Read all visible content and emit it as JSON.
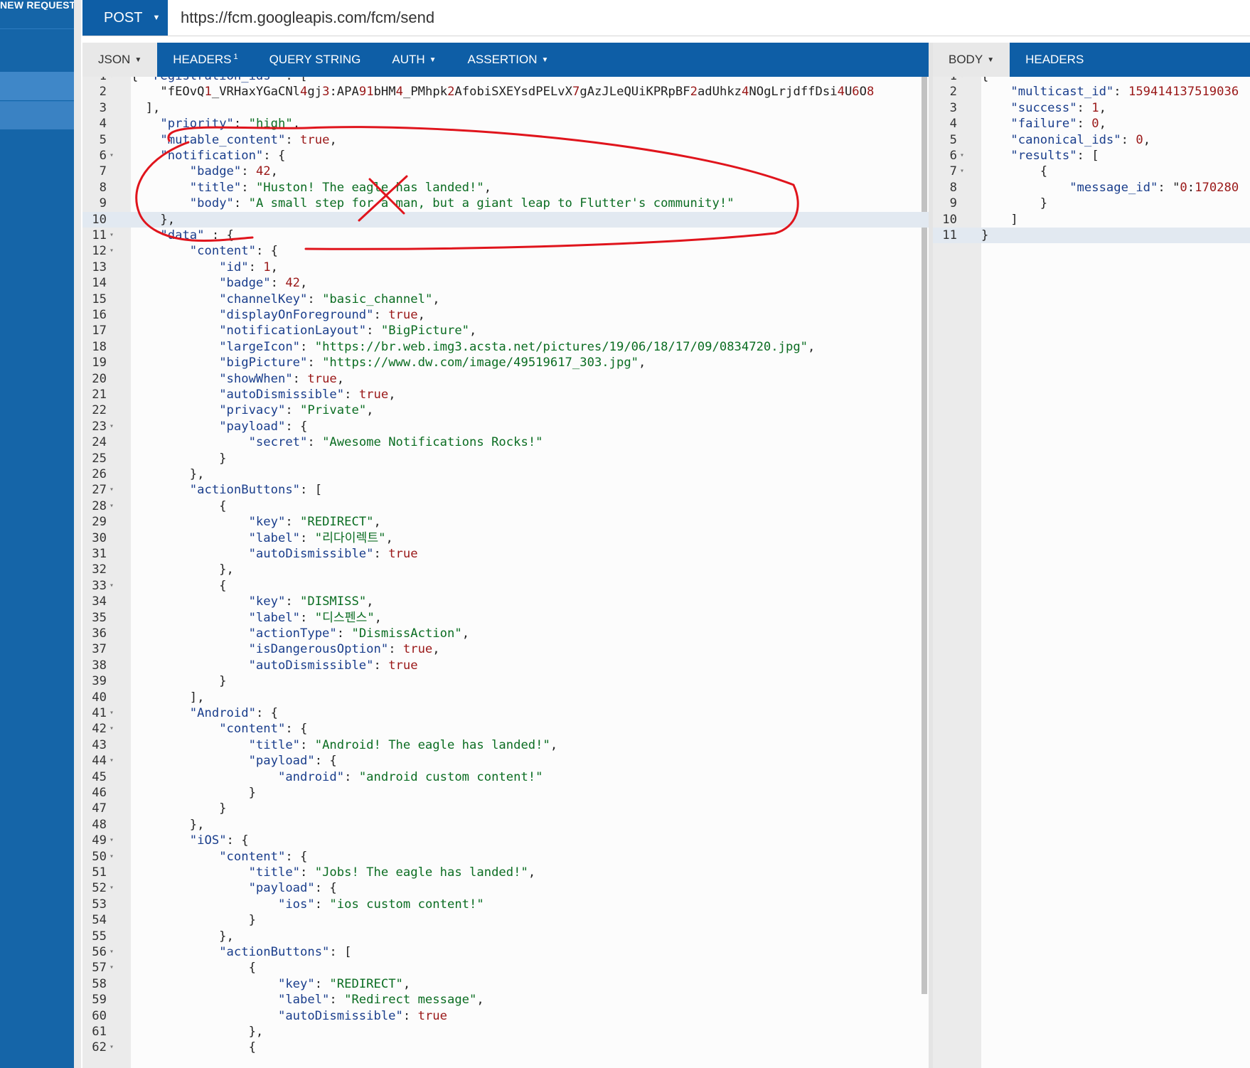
{
  "sidebar": {
    "new_request_label": "NEW REQUEST"
  },
  "request": {
    "method": "POST",
    "url": "https://fcm.googleapis.com/fcm/send",
    "tabs": [
      {
        "label": "JSON",
        "dropdown": true
      },
      {
        "label": "HEADERS",
        "badge": "1"
      },
      {
        "label": "QUERY STRING"
      },
      {
        "label": "AUTH",
        "dropdown": true
      },
      {
        "label": "ASSERTION",
        "dropdown": true
      }
    ],
    "editor": {
      "active_line": 10,
      "lines": [
        {
          "n": "1",
          "fold": true,
          "text": "{ \"registration_ids\" : ["
        },
        {
          "n": "2",
          "text": "    \"fEOvQ1_VRHaxYGaCNl4gj3:APA91bHM4_PMhpk2AfobiSXEYsdPELvX7gAzJLeQUiKPRpBF2adUhkz4NOgLrjdffDsi4U6O8"
        },
        {
          "n": "3",
          "text": "  ],"
        },
        {
          "n": "4",
          "text": "    \"priority\": \"high\","
        },
        {
          "n": "5",
          "text": "    \"mutable_content\": true,"
        },
        {
          "n": "6",
          "fold": true,
          "text": "    \"notification\": {"
        },
        {
          "n": "7",
          "text": "        \"badge\": 42,"
        },
        {
          "n": "8",
          "text": "        \"title\": \"Huston! The eagle has landed!\","
        },
        {
          "n": "9",
          "text": "        \"body\": \"A small step for a man, but a giant leap to Flutter's community!\""
        },
        {
          "n": "10",
          "text": "    },"
        },
        {
          "n": "11",
          "fold": true,
          "text": "    \"data\" : {"
        },
        {
          "n": "12",
          "fold": true,
          "text": "        \"content\": {"
        },
        {
          "n": "13",
          "text": "            \"id\": 1,"
        },
        {
          "n": "14",
          "text": "            \"badge\": 42,"
        },
        {
          "n": "15",
          "text": "            \"channelKey\": \"basic_channel\","
        },
        {
          "n": "16",
          "text": "            \"displayOnForeground\": true,"
        },
        {
          "n": "17",
          "text": "            \"notificationLayout\": \"BigPicture\","
        },
        {
          "n": "18",
          "text": "            \"largeIcon\": \"https://br.web.img3.acsta.net/pictures/19/06/18/17/09/0834720.jpg\","
        },
        {
          "n": "19",
          "text": "            \"bigPicture\": \"https://www.dw.com/image/49519617_303.jpg\","
        },
        {
          "n": "20",
          "text": "            \"showWhen\": true,"
        },
        {
          "n": "21",
          "text": "            \"autoDismissible\": true,"
        },
        {
          "n": "22",
          "text": "            \"privacy\": \"Private\","
        },
        {
          "n": "23",
          "fold": true,
          "text": "            \"payload\": {"
        },
        {
          "n": "24",
          "text": "                \"secret\": \"Awesome Notifications Rocks!\""
        },
        {
          "n": "25",
          "text": "            }"
        },
        {
          "n": "26",
          "text": "        },"
        },
        {
          "n": "27",
          "fold": true,
          "text": "        \"actionButtons\": ["
        },
        {
          "n": "28",
          "fold": true,
          "text": "            {"
        },
        {
          "n": "29",
          "text": "                \"key\": \"REDIRECT\","
        },
        {
          "n": "30",
          "text": "                \"label\": \"리다이렉트\","
        },
        {
          "n": "31",
          "text": "                \"autoDismissible\": true"
        },
        {
          "n": "32",
          "text": "            },"
        },
        {
          "n": "33",
          "fold": true,
          "text": "            {"
        },
        {
          "n": "34",
          "text": "                \"key\": \"DISMISS\","
        },
        {
          "n": "35",
          "text": "                \"label\": \"디스펜스\","
        },
        {
          "n": "36",
          "text": "                \"actionType\": \"DismissAction\","
        },
        {
          "n": "37",
          "text": "                \"isDangerousOption\": true,"
        },
        {
          "n": "38",
          "text": "                \"autoDismissible\": true"
        },
        {
          "n": "39",
          "text": "            }"
        },
        {
          "n": "40",
          "text": "        ],"
        },
        {
          "n": "41",
          "fold": true,
          "text": "        \"Android\": {"
        },
        {
          "n": "42",
          "fold": true,
          "text": "            \"content\": {"
        },
        {
          "n": "43",
          "text": "                \"title\": \"Android! The eagle has landed!\","
        },
        {
          "n": "44",
          "fold": true,
          "text": "                \"payload\": {"
        },
        {
          "n": "45",
          "text": "                    \"android\": \"android custom content!\""
        },
        {
          "n": "46",
          "text": "                }"
        },
        {
          "n": "47",
          "text": "            }"
        },
        {
          "n": "48",
          "text": "        },"
        },
        {
          "n": "49",
          "fold": true,
          "text": "        \"iOS\": {"
        },
        {
          "n": "50",
          "fold": true,
          "text": "            \"content\": {"
        },
        {
          "n": "51",
          "text": "                \"title\": \"Jobs! The eagle has landed!\","
        },
        {
          "n": "52",
          "fold": true,
          "text": "                \"payload\": {"
        },
        {
          "n": "53",
          "text": "                    \"ios\": \"ios custom content!\""
        },
        {
          "n": "54",
          "text": "                }"
        },
        {
          "n": "55",
          "text": "            },"
        },
        {
          "n": "56",
          "fold": true,
          "text": "            \"actionButtons\": ["
        },
        {
          "n": "57",
          "fold": true,
          "text": "                {"
        },
        {
          "n": "58",
          "text": "                    \"key\": \"REDIRECT\","
        },
        {
          "n": "59",
          "text": "                    \"label\": \"Redirect message\","
        },
        {
          "n": "60",
          "text": "                    \"autoDismissible\": true"
        },
        {
          "n": "61",
          "text": "                },"
        },
        {
          "n": "62",
          "fold": true,
          "text": "                {"
        }
      ]
    }
  },
  "response": {
    "tabs": [
      {
        "label": "BODY",
        "dropdown": true
      },
      {
        "label": "HEADERS"
      }
    ],
    "editor": {
      "active_line": 11,
      "lines": [
        {
          "n": "1",
          "fold": true,
          "text": "{"
        },
        {
          "n": "2",
          "text": "    \"multicast_id\": 159414137519036"
        },
        {
          "n": "3",
          "text": "    \"success\": 1,"
        },
        {
          "n": "4",
          "text": "    \"failure\": 0,"
        },
        {
          "n": "5",
          "text": "    \"canonical_ids\": 0,"
        },
        {
          "n": "6",
          "fold": true,
          "text": "    \"results\": ["
        },
        {
          "n": "7",
          "fold": true,
          "text": "        {"
        },
        {
          "n": "8",
          "text": "            \"message_id\": \"0:170280"
        },
        {
          "n": "9",
          "text": "        }"
        },
        {
          "n": "10",
          "text": "    ]"
        },
        {
          "n": "11",
          "text": "}"
        }
      ]
    }
  },
  "colors": {
    "brand": "#0e5ea6",
    "sidebar": "#1565a8",
    "annotation": "#e0141c"
  }
}
